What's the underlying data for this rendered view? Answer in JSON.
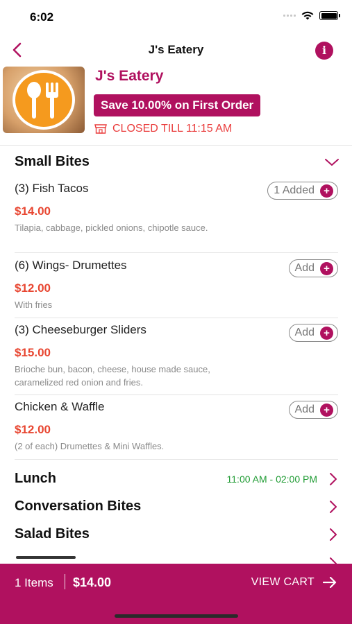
{
  "status": {
    "time": "6:02"
  },
  "nav": {
    "title": "J's Eatery",
    "back_icon": "chevron-left-icon",
    "info_icon": "info-icon",
    "info_glyph": "i"
  },
  "restaurant": {
    "name": "J's Eatery",
    "promo": "Save 10.00% on First Order",
    "status": "CLOSED TILL 11:15 AM",
    "accent": "#b0115f",
    "closed_color": "#ea3d3d"
  },
  "expanded_section": {
    "title": "Small Bites",
    "items": [
      {
        "name": "(3) Fish Tacos",
        "price": "$14.00",
        "desc": "Tilapia, cabbage, pickled onions, chipotle sauce.",
        "button": "1 Added"
      },
      {
        "name": "(6) Wings- Drumettes",
        "price": "$12.00",
        "desc": "With fries",
        "button": "Add"
      },
      {
        "name": "(3) Cheeseburger Sliders",
        "price": "$15.00",
        "desc": "Brioche bun, bacon, cheese, house made sauce, caramelized red onion and fries.",
        "button": "Add"
      },
      {
        "name": "Chicken & Waffle",
        "price": "$12.00",
        "desc": "(2 of each) Drumettes & Mini Waffles.",
        "button": "Add"
      }
    ]
  },
  "categories": [
    {
      "label": "Lunch",
      "time": "11:00 AM - 02:00 PM"
    },
    {
      "label": "Conversation Bites",
      "time": ""
    },
    {
      "label": "Salad Bites",
      "time": ""
    }
  ],
  "cart": {
    "count": "1 Items",
    "total": "$14.00",
    "view_label": "VIEW CART"
  }
}
